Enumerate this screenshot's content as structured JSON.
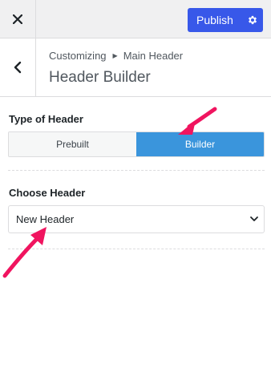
{
  "topbar": {
    "close_icon": "close-icon",
    "publish_label": "Publish",
    "settings_icon": "gear-icon",
    "accent_color": "#3858e9"
  },
  "title": {
    "back_icon": "chevron-left-icon",
    "breadcrumb": {
      "parent": "Customizing",
      "current": "Main Header",
      "separator_icon": "triangle-right-icon"
    },
    "panel_title": "Header Builder"
  },
  "type_of_header": {
    "label": "Type of Header",
    "options": [
      "Prebuilt",
      "Builder"
    ],
    "selected": "Builder",
    "active_color": "#3a95dc"
  },
  "choose_header": {
    "label": "Choose Header",
    "value": "New Header",
    "chevron_icon": "chevron-down-icon"
  },
  "annotations": {
    "arrow_color": "#f0145f"
  }
}
